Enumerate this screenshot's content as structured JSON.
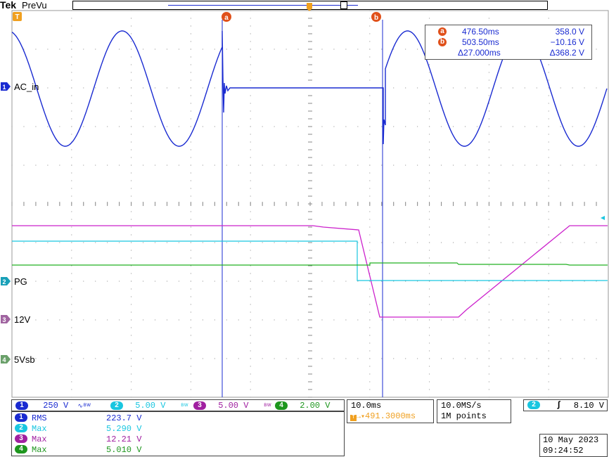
{
  "header": {
    "brand": "Tek",
    "mode": "PreVu"
  },
  "markers": {
    "trigger": "T",
    "cursor_a": "a",
    "cursor_b": "b"
  },
  "cursor_readout": {
    "a_time": "476.50ms",
    "a_value": "358.0 V",
    "b_time": "503.50ms",
    "b_value": "−10.16 V",
    "delta_time": "Δ27.000ms",
    "delta_value": "Δ368.2 V"
  },
  "channel_labels": {
    "ch1": {
      "num": "1",
      "name": "AC_in"
    },
    "ch2": {
      "num": "2",
      "name": "PG"
    },
    "ch3": {
      "num": "3",
      "name": "12V"
    },
    "ch4": {
      "num": "4",
      "name": "5Vsb"
    }
  },
  "scales": {
    "ch1": {
      "num": "1",
      "value": "250 V",
      "suffix": "ᴺₙ"
    },
    "ch2": {
      "num": "2",
      "value": "5.00 V"
    },
    "ch3": {
      "num": "3",
      "value": "5.00 V"
    },
    "ch4": {
      "num": "4",
      "value": "2.00 V"
    }
  },
  "measurements": [
    {
      "num": "1",
      "label": "RMS",
      "value": "223.7 V"
    },
    {
      "num": "2",
      "label": "Max",
      "value": "5.290 V"
    },
    {
      "num": "3",
      "label": "Max",
      "value": "12.21 V"
    },
    {
      "num": "4",
      "label": "Max",
      "value": "5.010 V"
    }
  ],
  "timebase": {
    "scale": "10.0ms",
    "position": "491.3000ms"
  },
  "acquisition": {
    "rate": "10.0MS/s",
    "points": "1M points"
  },
  "trigger": {
    "num": "2",
    "level": "8.10 V"
  },
  "datetime": {
    "date": "10 May 2023",
    "time": "09:24:52"
  },
  "colors": {
    "ch1": "#1a2bd1",
    "ch2": "#19c6e0",
    "ch3": "#cc22cc",
    "ch4": "#22b022",
    "cursor": "#1a2bd1",
    "marker": "#e0501a",
    "trigger_marker": "#f0a020",
    "grid": "#9a9a9a"
  }
}
